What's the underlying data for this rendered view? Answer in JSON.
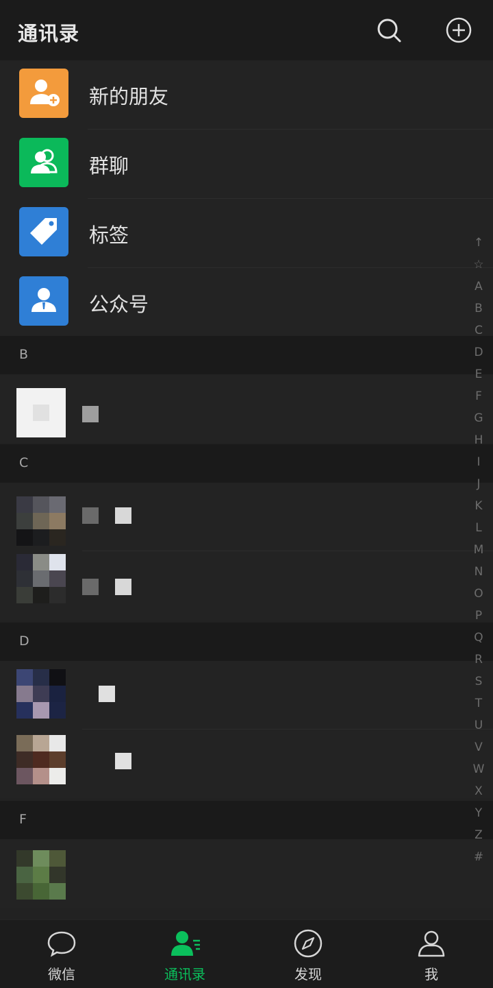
{
  "header": {
    "title": "通讯录"
  },
  "functions": [
    {
      "label": "新的朋友",
      "color": "#f39b3c",
      "icon": "add-friend-icon"
    },
    {
      "label": "群聊",
      "color": "#0bb95a",
      "icon": "group-chat-icon"
    },
    {
      "label": "标签",
      "color": "#2f7fd6",
      "icon": "tag-icon"
    },
    {
      "label": "公众号",
      "color": "#2f7fd6",
      "icon": "official-account-icon"
    }
  ],
  "sections": [
    "B",
    "C",
    "D",
    "F"
  ],
  "index_letters": [
    "↑",
    "☆",
    "A",
    "B",
    "C",
    "D",
    "E",
    "F",
    "G",
    "H",
    "I",
    "J",
    "K",
    "L",
    "M",
    "N",
    "O",
    "P",
    "Q",
    "R",
    "S",
    "T",
    "U",
    "V",
    "W",
    "X",
    "Y",
    "Z",
    "#"
  ],
  "tabs": [
    {
      "label": "微信",
      "icon": "chat-bubble-icon",
      "active": false
    },
    {
      "label": "通讯录",
      "icon": "contacts-icon",
      "active": true
    },
    {
      "label": "发现",
      "icon": "compass-icon",
      "active": false
    },
    {
      "label": "我",
      "icon": "person-icon",
      "active": false
    }
  ],
  "accent_color": "#0bbf5c"
}
